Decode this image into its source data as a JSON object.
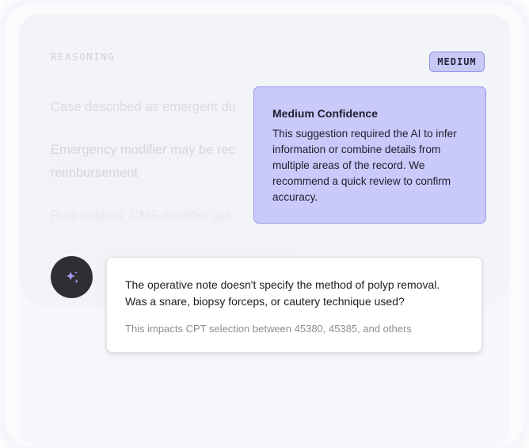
{
  "reasoning": {
    "label": "REASONING",
    "lines": [
      "Case described as emergent du",
      "Emergency modifier may be rec reimbursement",
      "Rule citation: CMS modifier gui"
    ]
  },
  "confidence_badge": {
    "label": "MEDIUM",
    "color": "#c9c9f6"
  },
  "tooltip": {
    "title": "Medium Confidence",
    "body": "This suggestion required the AI to infer information or combine details from multiple areas of the record. We recommend a quick review to confirm accuracy."
  },
  "assistant": {
    "avatar_icon": "sparkle-icon",
    "question": "The operative note doesn't specify the method of polyp removal. Was a snare, biopsy forceps, or cautery technique used?",
    "note": "This impacts CPT selection between 45380, 45385, and others"
  },
  "colors": {
    "accent": "#9b9be8",
    "avatar_bg": "#2e2e33",
    "sparkle": "#a99bf5"
  }
}
